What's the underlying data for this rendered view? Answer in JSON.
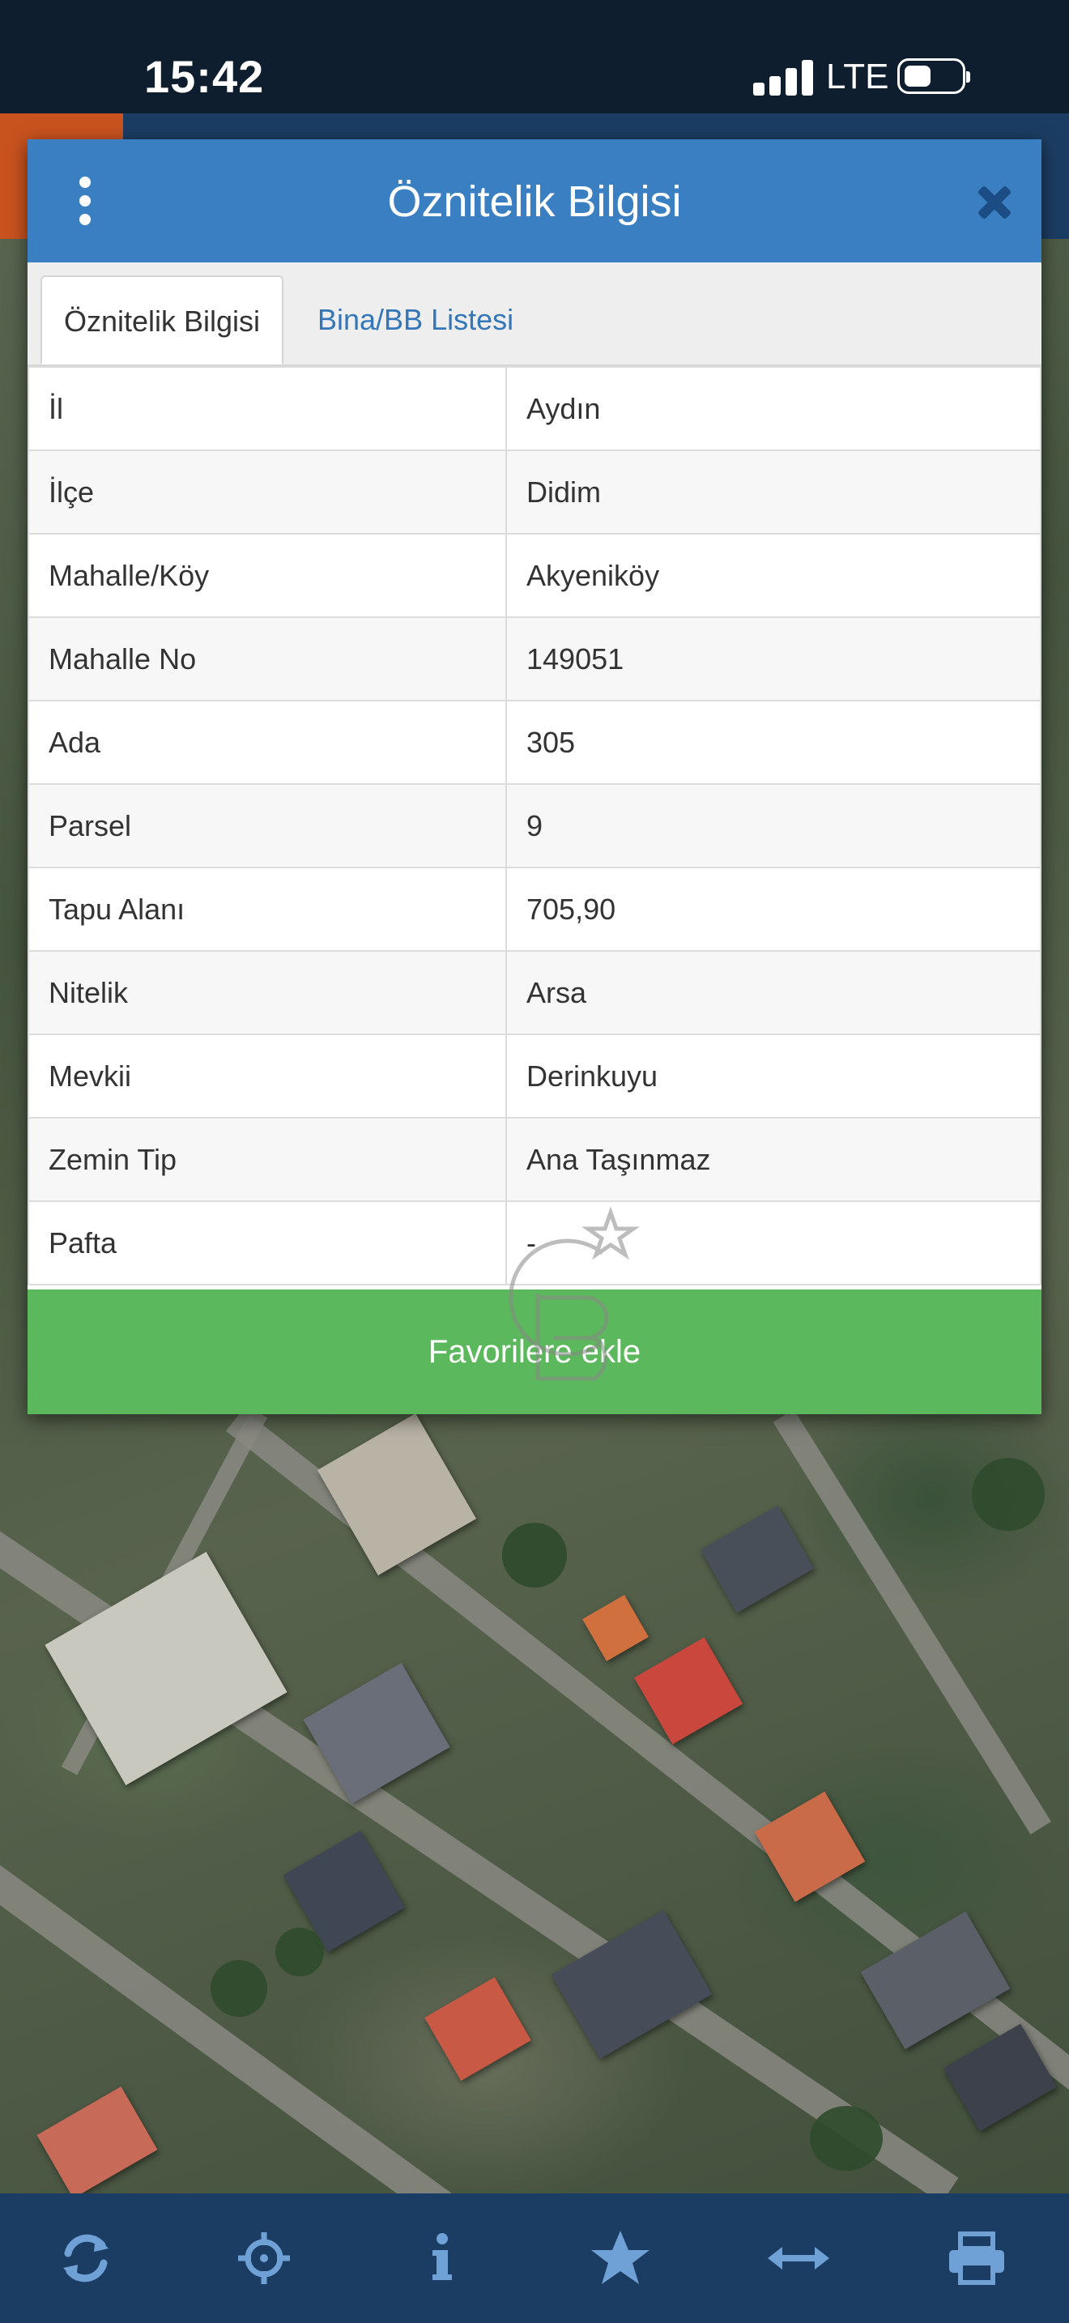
{
  "status_bar": {
    "time": "15:42",
    "network": "LTE",
    "icons": [
      "signal-icon",
      "battery-icon"
    ]
  },
  "modal": {
    "title": "Öznitelik Bilgisi",
    "header_color": "#3b7fc3",
    "menu_icon": "kebab-menu-icon",
    "close_icon": "close-icon",
    "tabs": [
      {
        "label": "Öznitelik Bilgisi",
        "active": true
      },
      {
        "label": "Bina/BB Listesi",
        "active": false
      }
    ],
    "attributes": [
      {
        "key": "İl",
        "value": "Aydın"
      },
      {
        "key": "İlçe",
        "value": "Didim"
      },
      {
        "key": "Mahalle/Köy",
        "value": "Akyeniköy"
      },
      {
        "key": "Mahalle No",
        "value": "149051"
      },
      {
        "key": "Ada",
        "value": "305"
      },
      {
        "key": "Parsel",
        "value": "9"
      },
      {
        "key": "Tapu Alanı",
        "value": "705,90"
      },
      {
        "key": "Nitelik",
        "value": "Arsa"
      },
      {
        "key": "Mevkii",
        "value": "Derinkuyu"
      },
      {
        "key": "Zemin Tip",
        "value": "Ana Taşınmaz"
      },
      {
        "key": "Pafta",
        "value": "-"
      }
    ],
    "favorite_button": {
      "label": "Favorilere ekle",
      "color": "#5cb85c"
    }
  },
  "toolbar": {
    "background": "#1c3d63",
    "icon_color": "#6fa0d6",
    "buttons": [
      {
        "icon": "refresh-icon"
      },
      {
        "icon": "crosshair-icon"
      },
      {
        "icon": "info-icon"
      },
      {
        "icon": "star-icon"
      },
      {
        "icon": "measure-arrows-icon"
      },
      {
        "icon": "print-icon"
      }
    ]
  }
}
